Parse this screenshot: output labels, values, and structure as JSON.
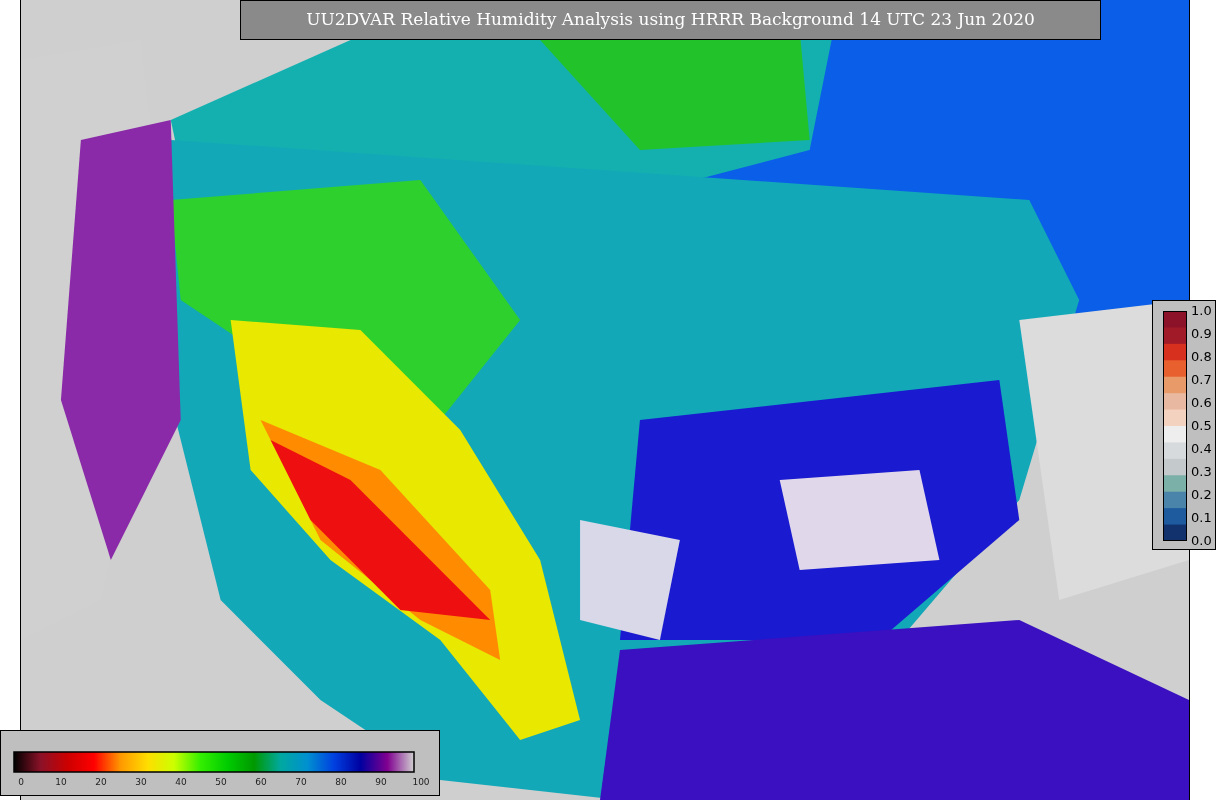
{
  "title": "UU2DVAR Relative Humidity Analysis using HRRR Background 14 UTC 23 Jun 2020",
  "right_colorbar": {
    "labels": [
      "1.0",
      "0.9",
      "0.8",
      "0.7",
      "0.6",
      "0.5",
      "0.4",
      "0.3",
      "0.2",
      "0.1",
      "0.0"
    ]
  },
  "bottom_colorbar": {
    "labels": [
      "0",
      "10",
      "20",
      "30",
      "40",
      "50",
      "60",
      "70",
      "80",
      "90",
      "100"
    ]
  }
}
